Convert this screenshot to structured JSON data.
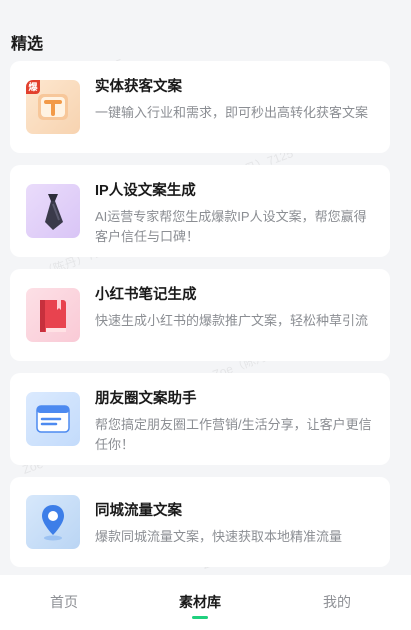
{
  "section": {
    "title": "精选"
  },
  "cards": [
    {
      "title": "实体获客文案",
      "desc": "一键输入行业和需求，即可秒出高转化获客文案",
      "badge": "爆",
      "icon": "paper-crane-icon"
    },
    {
      "title": "IP人设文案生成",
      "desc": "AI运营专家帮您生成爆款IP人设文案，帮您赢得客户信任与口碑！",
      "icon": "necktie-icon"
    },
    {
      "title": "小红书笔记生成",
      "desc": "快速生成小红书的爆款推广文案，轻松种草引流",
      "icon": "red-book-icon"
    },
    {
      "title": "朋友圈文案助手",
      "desc": "帮您搞定朋友圈工作营销/生活分享，让客户更信任你！",
      "icon": "browser-window-icon"
    },
    {
      "title": "同城流量文案",
      "desc": "爆款同城流量文案，快速获取本地精准流量",
      "icon": "location-pin-icon"
    }
  ],
  "tabbar": {
    "tabs": [
      {
        "label": "首页"
      },
      {
        "label": "素材库"
      },
      {
        "label": "我的"
      }
    ],
    "active_index": 1
  },
  "watermark": "Zoe（陈丹）7125",
  "colors": {
    "accent": "#1fd07e",
    "badge": "#e2402e"
  }
}
